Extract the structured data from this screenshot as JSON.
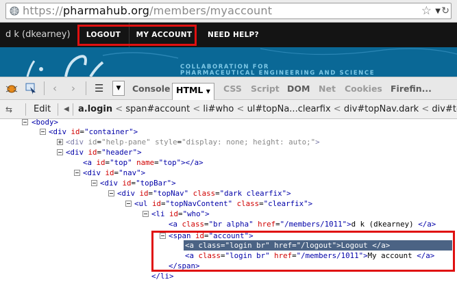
{
  "browser": {
    "url_prefix": "https://",
    "url_host": "pharmahub.org",
    "url_path": "/members/myaccount"
  },
  "site_nav": {
    "user_label": "d k (dkearney)",
    "logout": "LOGOUT",
    "my_account": "MY ACCOUNT",
    "need_help": "NEED HELP?"
  },
  "banner": {
    "line1": "COLLABORATION FOR",
    "line2": "PHARMACEUTICAL ENGINEERING AND SCIENCE"
  },
  "firebug": {
    "tabs": [
      "Console",
      "HTML",
      "CSS",
      "Script",
      "DOM",
      "Net",
      "Cookies",
      "Firefin..."
    ],
    "active_tab": "HTML",
    "edit_label": "Edit",
    "breadcrumbs": [
      "a.login",
      "span#account",
      "li#who",
      "ul#topNa...clearfix",
      "div#topNav.dark",
      "div#top"
    ]
  },
  "tree": {
    "body": "<body>",
    "container_open": "<div",
    "container_attr": "id",
    "container_val": "\"container\"",
    "help_attr1": "id",
    "help_val1": "\"help-pane\"",
    "help_attr2": "style",
    "help_val2": "\"display: none; height: auto;\"",
    "header_val": "\"header\"",
    "top_attr2": "name",
    "top_val1": "\"top\"",
    "top_val2": "\"top\"",
    "nav_val": "\"nav\"",
    "topbar_val": "\"topBar\"",
    "topnav_val1": "\"topNav\"",
    "topnav_attr2": "class",
    "topnav_val2": "\"dark clearfix\"",
    "ul_val1": "\"topNavContent\"",
    "ul_val2": "\"clearfix\"",
    "li_val": "\"who\"",
    "who_class": "\"br alpha\"",
    "who_href": "\"/members/1011\"",
    "who_text": "d k (dkearney)",
    "span_val": "\"account\"",
    "logout_class": "\"login br\"",
    "logout_href": "\"/logout\"",
    "logout_text": "Logout",
    "acct_class": "\"login br\"",
    "acct_href": "\"/members/1011\"",
    "acct_text": "My account",
    "span_close": "</span>",
    "li_close": "</li>"
  }
}
